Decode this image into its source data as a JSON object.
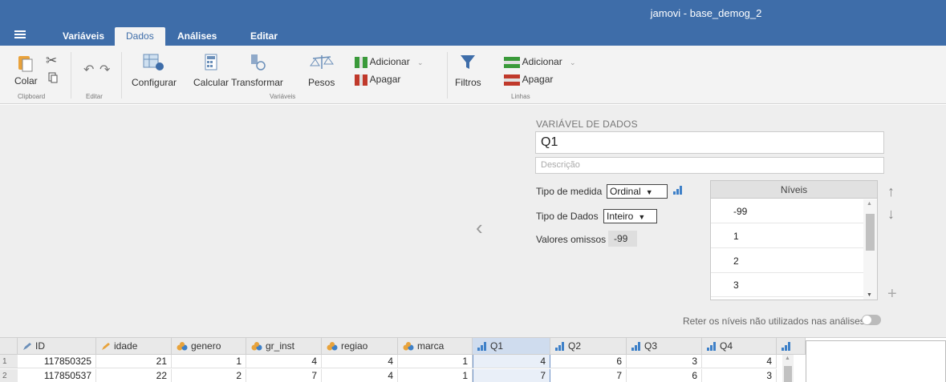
{
  "app": {
    "title": "jamovi - base_demog_2"
  },
  "menu_tabs": [
    {
      "label": "Variáveis",
      "active": false
    },
    {
      "label": "Dados",
      "active": true
    },
    {
      "label": "Análises",
      "active": false
    },
    {
      "label": "Editar",
      "active": false
    }
  ],
  "ribbon": {
    "clipboard": {
      "paste": "Colar",
      "group": "Clipboard"
    },
    "edit": {
      "group": "Editar"
    },
    "variables": {
      "setup": "Configurar",
      "compute": "Calcular",
      "transform": "Transformar",
      "weights": "Pesos",
      "add": "Adicionar",
      "delete": "Apagar",
      "group": "Variáveis"
    },
    "filters": "Filtros",
    "rows": {
      "add": "Adicionar",
      "delete": "Apagar",
      "group": "Linhas"
    }
  },
  "variable_editor": {
    "section_title": "VARIÁVEL DE DADOS",
    "name": "Q1",
    "description_placeholder": "Descrição",
    "measure_type_label": "Tipo de medida",
    "measure_type_value": "Ordinal",
    "data_type_label": "Tipo de Dados",
    "data_type_value": "Inteiro",
    "missing_label": "Valores omissos",
    "missing_value": "-99",
    "levels_header": "Níveis",
    "levels": [
      "-99",
      "1",
      "2",
      "3"
    ],
    "retain_label": "Reter os níveis não utilizados nas análises",
    "retain_enabled": false
  },
  "grid": {
    "columns": [
      {
        "name": "ID",
        "type": "id"
      },
      {
        "name": "idade",
        "type": "continuous"
      },
      {
        "name": "genero",
        "type": "nominal"
      },
      {
        "name": "gr_inst",
        "type": "nominal"
      },
      {
        "name": "regiao",
        "type": "nominal"
      },
      {
        "name": "marca",
        "type": "nominal"
      },
      {
        "name": "Q1",
        "type": "ordinal",
        "selected": true
      },
      {
        "name": "Q2",
        "type": "ordinal"
      },
      {
        "name": "Q3",
        "type": "ordinal"
      },
      {
        "name": "Q4",
        "type": "ordinal"
      },
      {
        "name": "",
        "type": "ordinal"
      }
    ],
    "rows": [
      {
        "num": "1",
        "cells": [
          "117850325",
          "21",
          "1",
          "4",
          "4",
          "1",
          "4",
          "6",
          "3",
          "4"
        ]
      },
      {
        "num": "2",
        "cells": [
          "117850537",
          "22",
          "2",
          "7",
          "4",
          "1",
          "7",
          "7",
          "6",
          "3"
        ]
      }
    ]
  },
  "colors": {
    "brand": "#3e6da9",
    "ribbon_bg": "#f3f3f3",
    "selection": "#cfdcee"
  }
}
